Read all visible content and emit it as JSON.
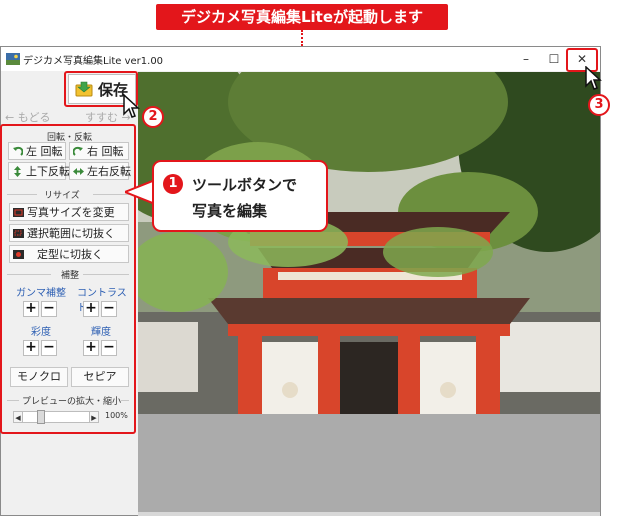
{
  "banner": {
    "text": "デジカメ写真編集Liteが起動します"
  },
  "window": {
    "title": "デジカメ写真編集Lite ver1.00",
    "controls": {
      "minimize": "–",
      "maximize": "☐",
      "close": "✕"
    }
  },
  "toolbar": {
    "save_label": "保存",
    "back_label": "← もどる",
    "forward_label": "すすむ →"
  },
  "panel": {
    "rotate_section": "回転・反転",
    "rotate_left": "左 回転",
    "rotate_right": "右 回転",
    "flip_vertical": "上下反転",
    "flip_horizontal": "左右反転",
    "resize_section": "リサイズ",
    "resize_photo": "写真サイズを変更",
    "crop_selection": "選択範囲に切抜く",
    "crop_fixed": "定型に切抜く",
    "adjust_section": "補整",
    "gamma": "ガンマ補整",
    "contrast": "コントラスト",
    "saturation": "彩度",
    "brightness": "輝度",
    "plus": "+",
    "minus": "−",
    "mono": "モノクロ",
    "sepia": "セピア",
    "preview_section": "プレビューの拡大・縮小",
    "zoom_value": "100%"
  },
  "callout": {
    "number": "1",
    "line1": "ツールボタンで",
    "line2": "写真を編集"
  },
  "steps": {
    "two": "2",
    "three": "3"
  },
  "colors": {
    "accent_red": "#e3161b",
    "adjust_blue": "#2d5fb3",
    "canvas_gray": "#ababab",
    "gate_vermilion": "#d8452b"
  }
}
